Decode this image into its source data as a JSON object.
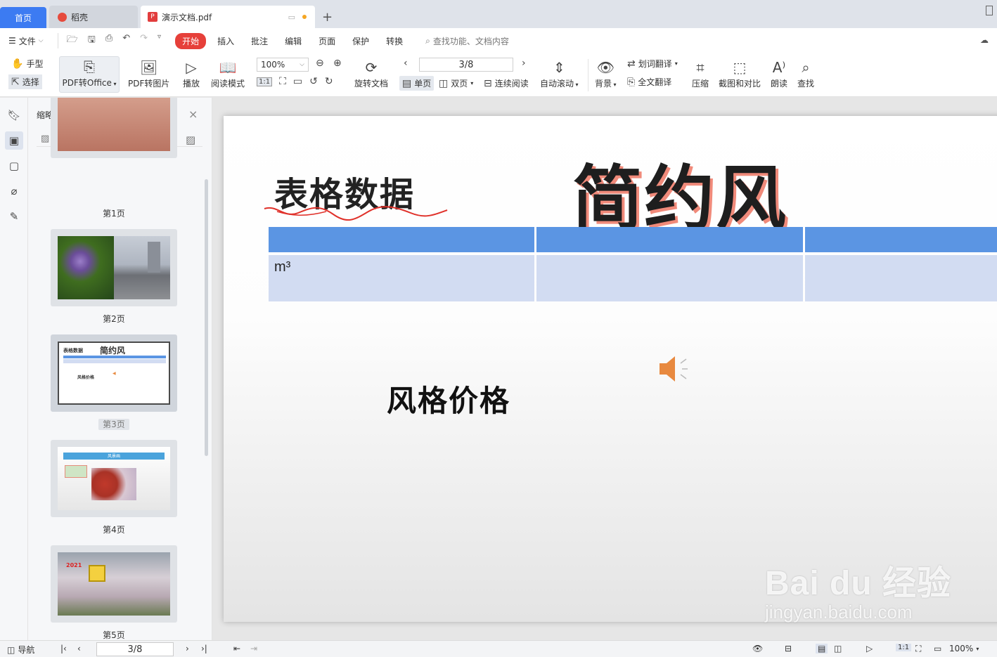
{
  "tabs": {
    "home": "首页",
    "daoke": "稻壳",
    "document": "演示文档.pdf"
  },
  "menu": {
    "file": "文件",
    "items": [
      "开始",
      "插入",
      "批注",
      "编辑",
      "页面",
      "保护",
      "转换"
    ],
    "search_placeholder": "查找功能、文档内容"
  },
  "ribbon": {
    "hand": "手型",
    "select": "选择",
    "pdf_to_office": "PDF转Office",
    "pdf_to_image": "PDF转图片",
    "play": "播放",
    "read_mode": "阅读模式",
    "zoom": "100%",
    "rotate_doc": "旋转文档",
    "page_indicator": "3/8",
    "single_page": "单页",
    "double_page": "双页",
    "continuous": "连续阅读",
    "auto_scroll": "自动滚动",
    "background": "背景",
    "word_translate": "划词翻译",
    "full_translate": "全文翻译",
    "compress": "压缩",
    "screenshot_compare": "截图和对比",
    "read_aloud": "朗读",
    "find": "查找"
  },
  "thumbnails": {
    "title": "缩略图",
    "pages": [
      {
        "label": "第1页"
      },
      {
        "label": "第2页"
      },
      {
        "label": "第3页",
        "selected": true
      },
      {
        "label": "第4页"
      },
      {
        "label": "第5页"
      }
    ],
    "thumb3_title_left": "表格数据",
    "thumb3_title_big": "简约风",
    "thumb3_subtitle": "风格价格",
    "thumb4_banner": "风景画",
    "thumb5_year": "2021"
  },
  "slide": {
    "title_left": "表格数据",
    "title_big": "简约风",
    "table_cell": "m³",
    "subtitle": "风格价格"
  },
  "watermark": {
    "main": "Bai du 经验",
    "sub": "jingyan.baidu.com"
  },
  "status": {
    "nav": "导航",
    "page": "3/8",
    "zoom": "100%"
  },
  "colors": {
    "accent_blue": "#3c7bf2",
    "start_red": "#e6403a",
    "table_header": "#5b95e3",
    "table_row": "#d2dcf2",
    "title_shadow": "#f08a7a",
    "speaker": "#e8893f"
  }
}
